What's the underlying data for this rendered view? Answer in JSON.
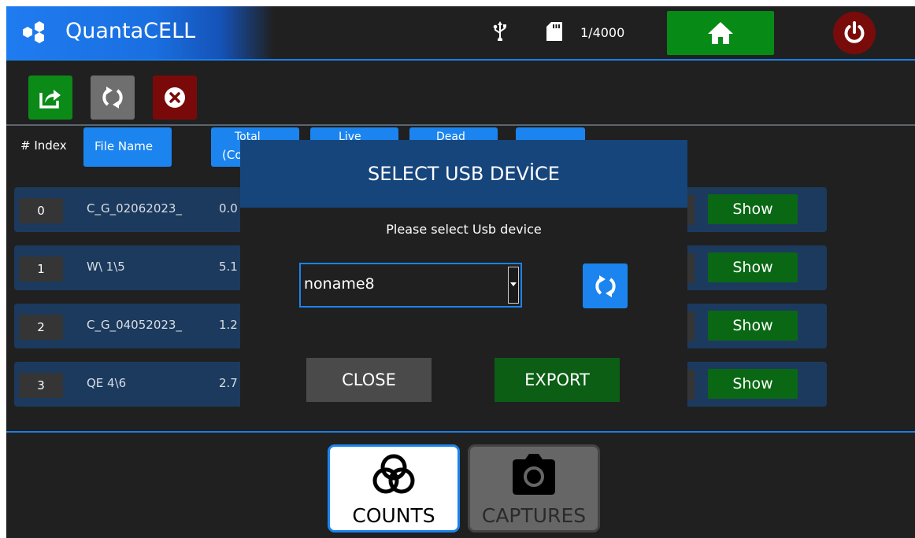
{
  "header": {
    "app_title": "QuantaCELL",
    "storage_count": "1/4000",
    "icons": [
      "logo-icon",
      "usb-icon",
      "sd-card-icon",
      "home-icon",
      "power-icon"
    ],
    "colors": {
      "brand": "#1f7cf0",
      "home": "#078a16",
      "power": "#7a0b0b"
    }
  },
  "toolbar": {
    "buttons": [
      {
        "icon": "export-icon",
        "color": "#0b8a18"
      },
      {
        "icon": "refresh-icon",
        "color": "#6f6f6f"
      },
      {
        "icon": "delete-icon",
        "color": "#7a0a0a"
      }
    ]
  },
  "columns": {
    "index": "# Index",
    "file_name": "File Name",
    "total_line1": "Total",
    "total_line2": "(Co",
    "live": "Live",
    "dead": "Dead"
  },
  "rows": [
    {
      "index": "0",
      "file_name": "C_G_02062023_",
      "total": "0.0",
      "action": "Show"
    },
    {
      "index": "1",
      "file_name": "W\\ 1\\5",
      "total": "5.1",
      "action": "Show"
    },
    {
      "index": "2",
      "file_name": "C_G_04052023_",
      "total": "1.2",
      "action": "Show"
    },
    {
      "index": "3",
      "file_name": "QE 4\\6",
      "total": "2.7",
      "action": "Show"
    }
  ],
  "dialog": {
    "title": "SELECT USB DEVİCE",
    "message": "Please select Usb device",
    "selected_device": "noname8",
    "close_label": "CLOSE",
    "export_label": "EXPORT"
  },
  "tabs": [
    {
      "label": "COUNTS",
      "icon": "counts-icon",
      "active": true
    },
    {
      "label": "CAPTURES",
      "icon": "camera-icon",
      "active": false
    }
  ]
}
